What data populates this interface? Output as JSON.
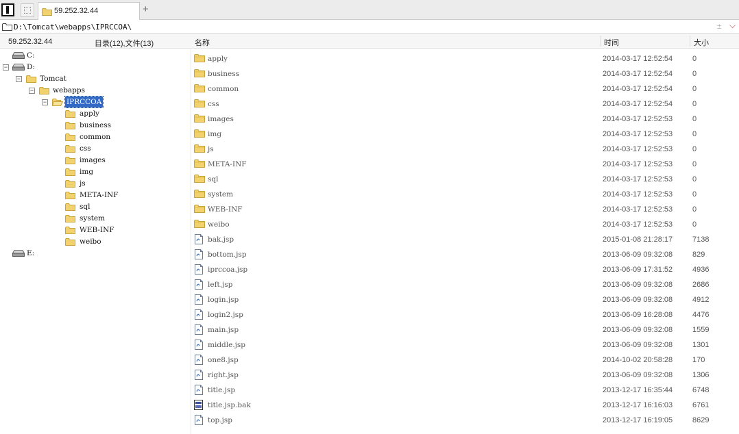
{
  "tab": {
    "title": "59.252.32.44",
    "new_tab_symbol": "+"
  },
  "path_bar": {
    "path": "D:\\Tomcat\\webapps\\IPRCCOA\\"
  },
  "status": {
    "host": "59.252.32.44",
    "counts": "目录(12),文件(13)"
  },
  "columns": {
    "name": "名称",
    "time": "时间",
    "size": "大小"
  },
  "tree": {
    "nodes": [
      {
        "label": "C:",
        "icon": "drive-icon",
        "toggle": ""
      },
      {
        "label": "D:",
        "icon": "drive-icon",
        "toggle": "−"
      },
      {
        "label": "Tomcat",
        "icon": "folder-icon",
        "toggle": "−"
      },
      {
        "label": "webapps",
        "icon": "folder-icon",
        "toggle": "−"
      },
      {
        "label": "IPRCCOA",
        "icon": "folder-open-icon",
        "toggle": "−",
        "selected": true
      },
      {
        "label": "apply",
        "icon": "folder-icon"
      },
      {
        "label": "business",
        "icon": "folder-icon"
      },
      {
        "label": "common",
        "icon": "folder-icon"
      },
      {
        "label": "css",
        "icon": "folder-icon"
      },
      {
        "label": "images",
        "icon": "folder-icon"
      },
      {
        "label": "img",
        "icon": "folder-icon"
      },
      {
        "label": "js",
        "icon": "folder-icon"
      },
      {
        "label": "META-INF",
        "icon": "folder-icon"
      },
      {
        "label": "sql",
        "icon": "folder-icon"
      },
      {
        "label": "system",
        "icon": "folder-icon"
      },
      {
        "label": "WEB-INF",
        "icon": "folder-icon"
      },
      {
        "label": "weibo",
        "icon": "folder-icon"
      },
      {
        "label": "E:",
        "icon": "drive-icon"
      }
    ]
  },
  "files": [
    {
      "name": "apply",
      "time": "2014-03-17 12:52:54",
      "size": "0",
      "icon": "folder-icon"
    },
    {
      "name": "business",
      "time": "2014-03-17 12:52:54",
      "size": "0",
      "icon": "folder-icon"
    },
    {
      "name": "common",
      "time": "2014-03-17 12:52:54",
      "size": "0",
      "icon": "folder-icon"
    },
    {
      "name": "css",
      "time": "2014-03-17 12:52:54",
      "size": "0",
      "icon": "folder-icon"
    },
    {
      "name": "images",
      "time": "2014-03-17 12:52:53",
      "size": "0",
      "icon": "folder-icon"
    },
    {
      "name": "img",
      "time": "2014-03-17 12:52:53",
      "size": "0",
      "icon": "folder-icon"
    },
    {
      "name": "js",
      "time": "2014-03-17 12:52:53",
      "size": "0",
      "icon": "folder-icon"
    },
    {
      "name": "META-INF",
      "time": "2014-03-17 12:52:53",
      "size": "0",
      "icon": "folder-icon"
    },
    {
      "name": "sql",
      "time": "2014-03-17 12:52:53",
      "size": "0",
      "icon": "folder-icon"
    },
    {
      "name": "system",
      "time": "2014-03-17 12:52:53",
      "size": "0",
      "icon": "folder-icon"
    },
    {
      "name": "WEB-INF",
      "time": "2014-03-17 12:52:53",
      "size": "0",
      "icon": "folder-icon"
    },
    {
      "name": "weibo",
      "time": "2014-03-17 12:52:53",
      "size": "0",
      "icon": "folder-icon"
    },
    {
      "name": "bak.jsp",
      "time": "2015-01-08 21:28:17",
      "size": "7138",
      "icon": "file-icon"
    },
    {
      "name": "bottom.jsp",
      "time": "2013-06-09 09:32:08",
      "size": "829",
      "icon": "file-icon"
    },
    {
      "name": "iprccoa.jsp",
      "time": "2013-06-09 17:31:52",
      "size": "4936",
      "icon": "file-icon"
    },
    {
      "name": "left.jsp",
      "time": "2013-06-09 09:32:08",
      "size": "2686",
      "icon": "file-icon"
    },
    {
      "name": "login.jsp",
      "time": "2013-06-09 09:32:08",
      "size": "4912",
      "icon": "file-icon"
    },
    {
      "name": "login2.jsp",
      "time": "2013-06-09 16:28:08",
      "size": "4476",
      "icon": "file-icon"
    },
    {
      "name": "main.jsp",
      "time": "2013-06-09 09:32:08",
      "size": "1559",
      "icon": "file-icon"
    },
    {
      "name": "middle.jsp",
      "time": "2013-06-09 09:32:08",
      "size": "1301",
      "icon": "file-icon"
    },
    {
      "name": "one8.jsp",
      "time": "2014-10-02 20:58:28",
      "size": "170",
      "icon": "file-icon"
    },
    {
      "name": "right.jsp",
      "time": "2013-06-09 09:32:08",
      "size": "1306",
      "icon": "file-icon"
    },
    {
      "name": "title.jsp",
      "time": "2013-12-17 16:35:44",
      "size": "6748",
      "icon": "file-icon"
    },
    {
      "name": "title.jsp.bak",
      "time": "2013-12-17 16:16:03",
      "size": "6761",
      "icon": "bak-file-icon"
    },
    {
      "name": "top.jsp",
      "time": "2013-12-17 16:19:05",
      "size": "8629",
      "icon": "file-icon"
    }
  ],
  "colors": {
    "folder": "#f2d26e",
    "folder_border": "#c9a43a",
    "selection": "#3169c6"
  }
}
